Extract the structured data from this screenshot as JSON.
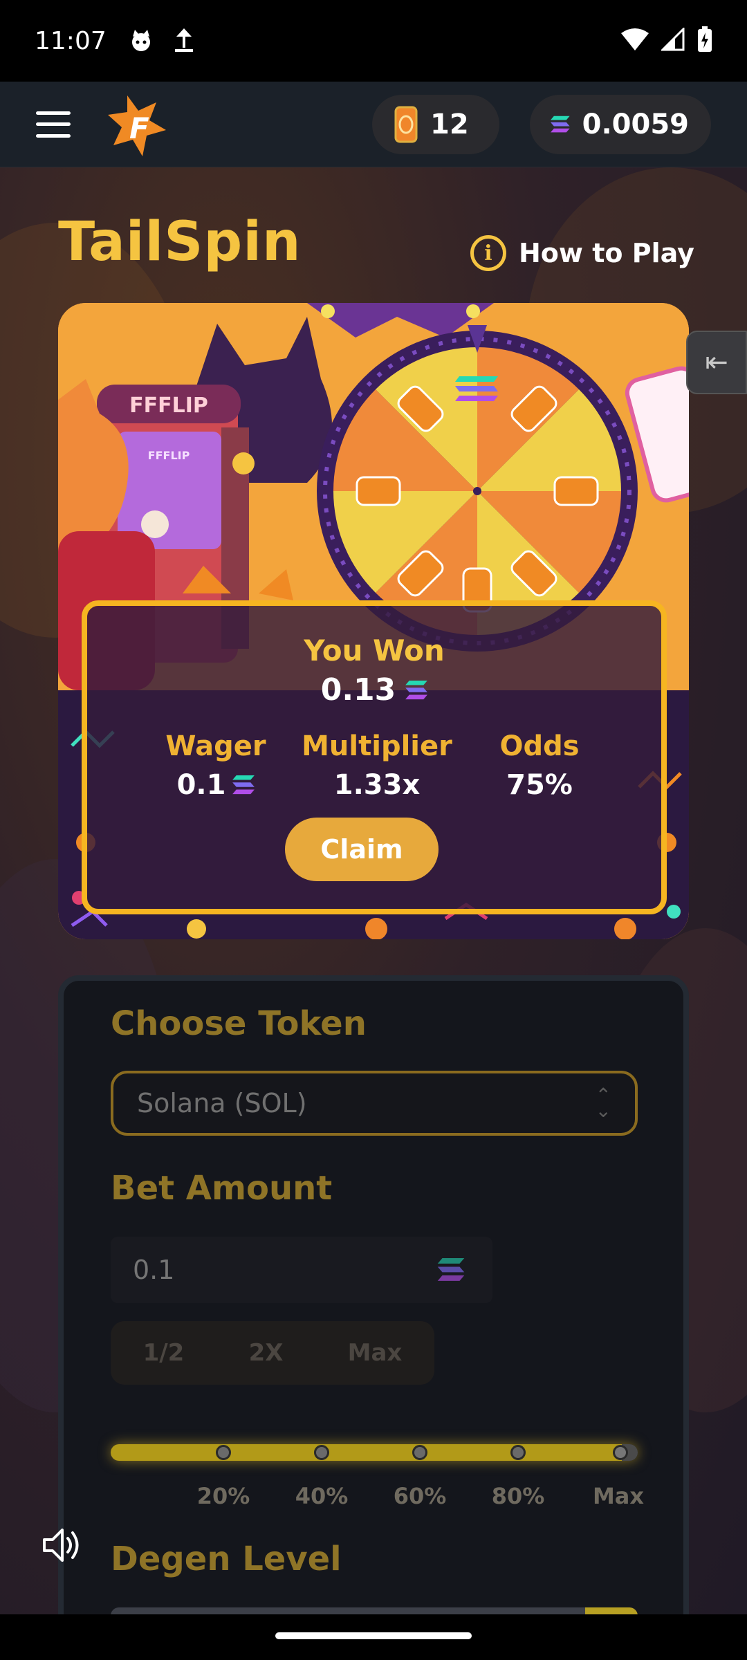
{
  "status_bar": {
    "time": "11:07",
    "icons": [
      "cat-face-icon",
      "upload-icon",
      "wifi-icon",
      "cellular-signal-icon",
      "battery-icon"
    ]
  },
  "header": {
    "logo": "fff-logo-icon",
    "cans_balance": "12",
    "sol_balance": "0.0059"
  },
  "game": {
    "title": "TailSpin",
    "how_to_play_label": "How to Play",
    "machine_sign": "FFFLIP",
    "screen_sign": "FFFLIP"
  },
  "result": {
    "you_won_label": "You Won",
    "won_amount": "0.13",
    "wager_label": "Wager",
    "wager_value": "0.1",
    "multiplier_label": "Multiplier",
    "multiplier_value": "1.33x",
    "odds_label": "Odds",
    "odds_value": "75%",
    "claim_label": "Claim"
  },
  "settings": {
    "choose_token_title": "Choose Token",
    "token_selected": "Solana (SOL)",
    "bet_amount_title": "Bet Amount",
    "bet_placeholder": "0.1",
    "quick_buttons": [
      "1/2",
      "2X",
      "Max"
    ],
    "slider_labels": [
      "20%",
      "40%",
      "60%",
      "80%",
      "Max"
    ],
    "slider_level_percent": 97,
    "degen_level_title": "Degen Level"
  },
  "colors": {
    "accent_gold": "#f5c441",
    "claim_button": "#e7a93c",
    "panel_border": "#f6b521",
    "header_bg": "#1b2129"
  }
}
